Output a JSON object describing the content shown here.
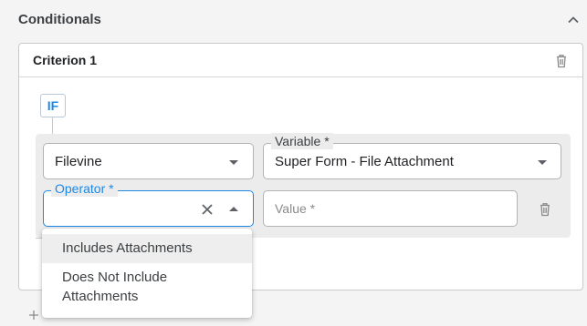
{
  "section": {
    "title": "Conditionals",
    "collapse_icon": "chevron-up-icon"
  },
  "criterion": {
    "title": "Criterion 1",
    "delete_icon": "trash-icon",
    "if_label": "IF",
    "source_field": {
      "value": "Filevine"
    },
    "variable_field": {
      "label": "Variable *",
      "value": "Super Form - File Attachment"
    },
    "operator_field": {
      "label": "Operator *",
      "value": ""
    },
    "value_field": {
      "placeholder": "Value *"
    },
    "row_delete_icon": "trash-icon"
  },
  "operator_menu": {
    "options": [
      "Includes Attachments",
      "Does Not Include",
      "Attachments"
    ],
    "highlighted_index": 0
  },
  "colors": {
    "accent": "#1e88e5",
    "card_border": "#c9c9c9",
    "condition_bg": "#ececec"
  }
}
